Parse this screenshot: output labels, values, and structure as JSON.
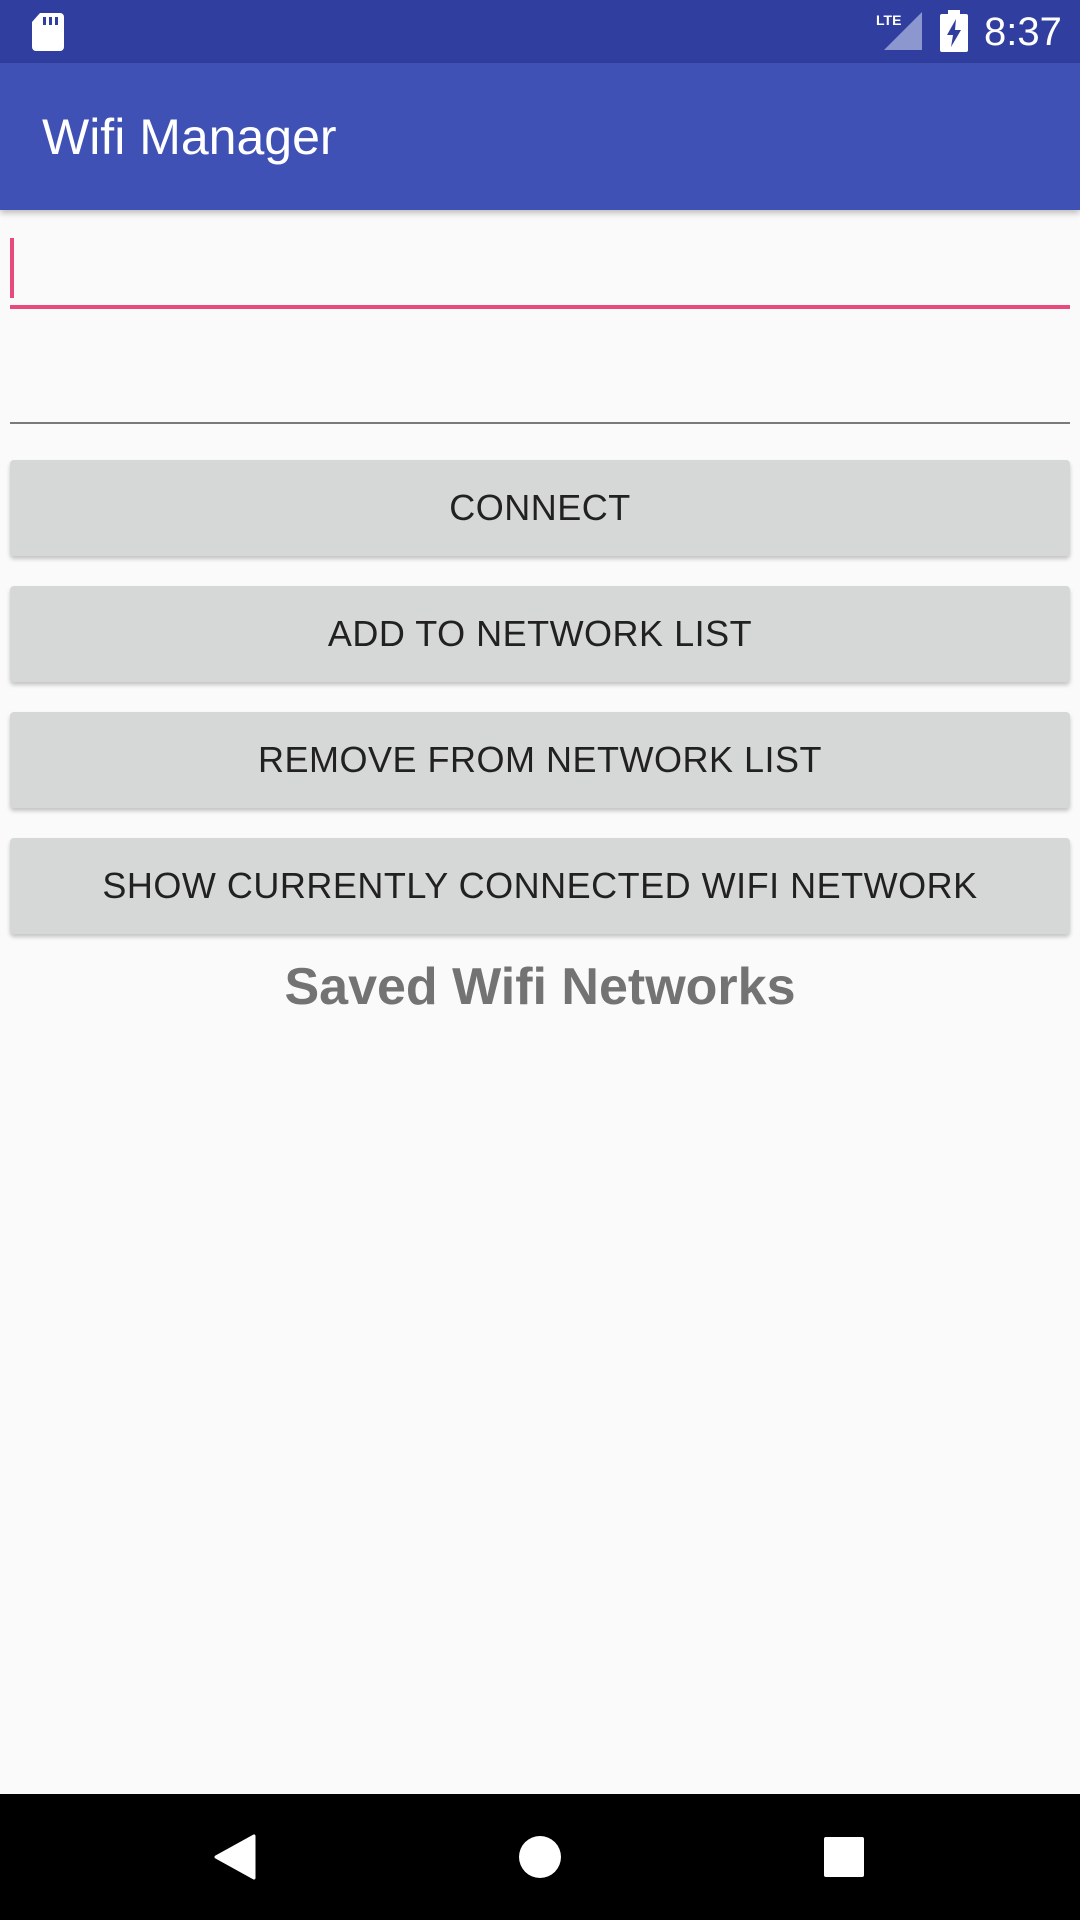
{
  "status_bar": {
    "time": "8:37",
    "network_label": "LTE",
    "icons": [
      "sd-card-icon",
      "lte-signal-icon",
      "battery-charging-icon"
    ]
  },
  "app_bar": {
    "title": "Wifi Manager",
    "color": "#3f51b5"
  },
  "form": {
    "ssid_value": "",
    "password_value": "",
    "accent_color": "#e94a7d"
  },
  "buttons": {
    "connect": "CONNECT",
    "add": "ADD TO NETWORK LIST",
    "remove": "REMOVE FROM NETWORK LIST",
    "show": "SHOW CURRENTLY CONNECTED WIFI NETWORK"
  },
  "saved_networks": {
    "title": "Saved Wifi Networks",
    "items": []
  },
  "nav_bar": {
    "icons": [
      "back-icon",
      "home-icon",
      "recents-icon"
    ]
  }
}
